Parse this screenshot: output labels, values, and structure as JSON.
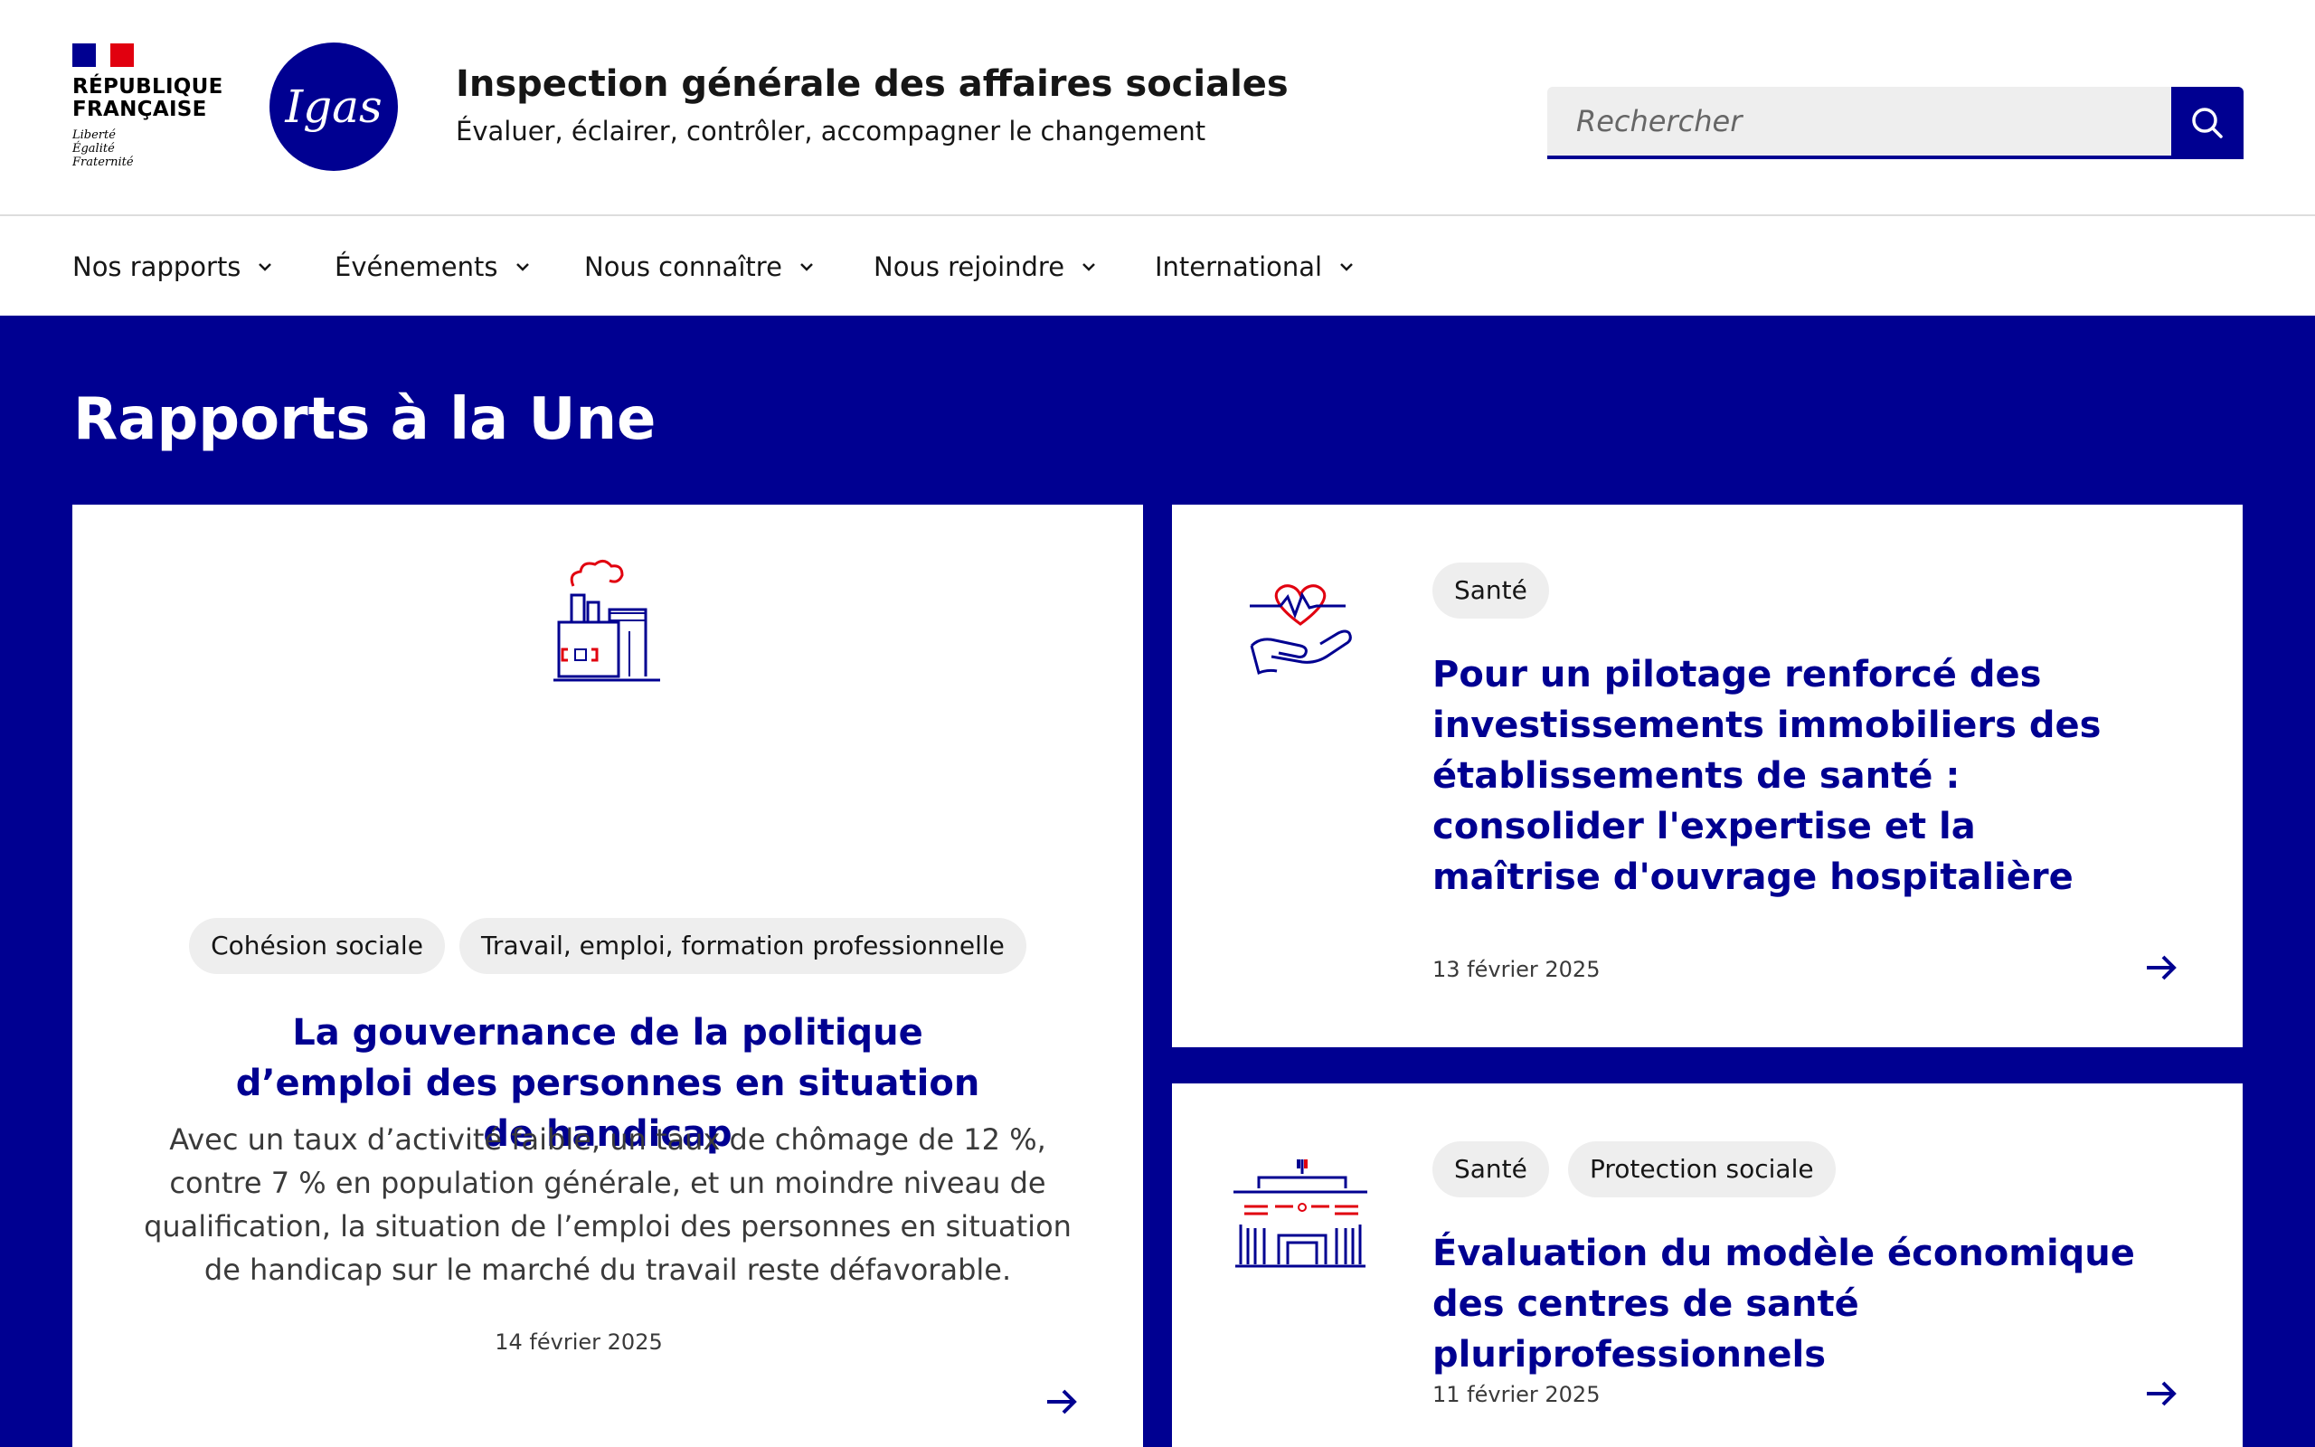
{
  "header": {
    "republic": "RÉPUBLIQUE\nFRANÇAISE",
    "republic_line1": "RÉPUBLIQUE",
    "republic_line2": "FRANÇAISE",
    "motto1": "Liberté",
    "motto2": "Égalité",
    "motto3": "Fraternité",
    "logo_text": "Igas",
    "title": "Inspection générale des affaires sociales",
    "tagline": "Évaluer, éclairer, contrôler, accompagner le changement"
  },
  "search": {
    "placeholder": "Rechercher"
  },
  "nav": {
    "items": [
      {
        "label": "Nos rapports"
      },
      {
        "label": "Événements"
      },
      {
        "label": "Nous connaître"
      },
      {
        "label": "Nous rejoindre"
      },
      {
        "label": "International"
      }
    ]
  },
  "main": {
    "section_title": "Rapports à la Une",
    "cards": [
      {
        "icon": "factory-icon",
        "tags": [
          "Cohésion sociale",
          "Travail, emploi, formation professionnelle"
        ],
        "title": "La gouvernance de la politique d’emploi des personnes en situation de handicap",
        "description": "Avec un taux d’activité faible, un taux de chômage de 12 %, contre 7 % en population générale, et un moindre niveau de qualification, la situation de l’emploi des personnes en situation de handicap sur le marché du travail reste défavorable.",
        "date": "14 février 2025"
      },
      {
        "icon": "heart-hand-icon",
        "tags": [
          "Santé"
        ],
        "title": "Pour un pilotage renforcé des investissements immobiliers des établissements de santé : consolider l'expertise et la maîtrise d'ouvrage hospitalière",
        "date": "13 février 2025"
      },
      {
        "icon": "public-building-icon",
        "tags": [
          "Santé",
          "Protection sociale"
        ],
        "title": "Évaluation du modèle économique des centres de santé pluriprofessionnels",
        "date": "11 février 2025"
      }
    ]
  },
  "colors": {
    "brand_blue": "#000091",
    "marianne_red": "#e1000f",
    "tag_bg": "#eeeeee"
  }
}
